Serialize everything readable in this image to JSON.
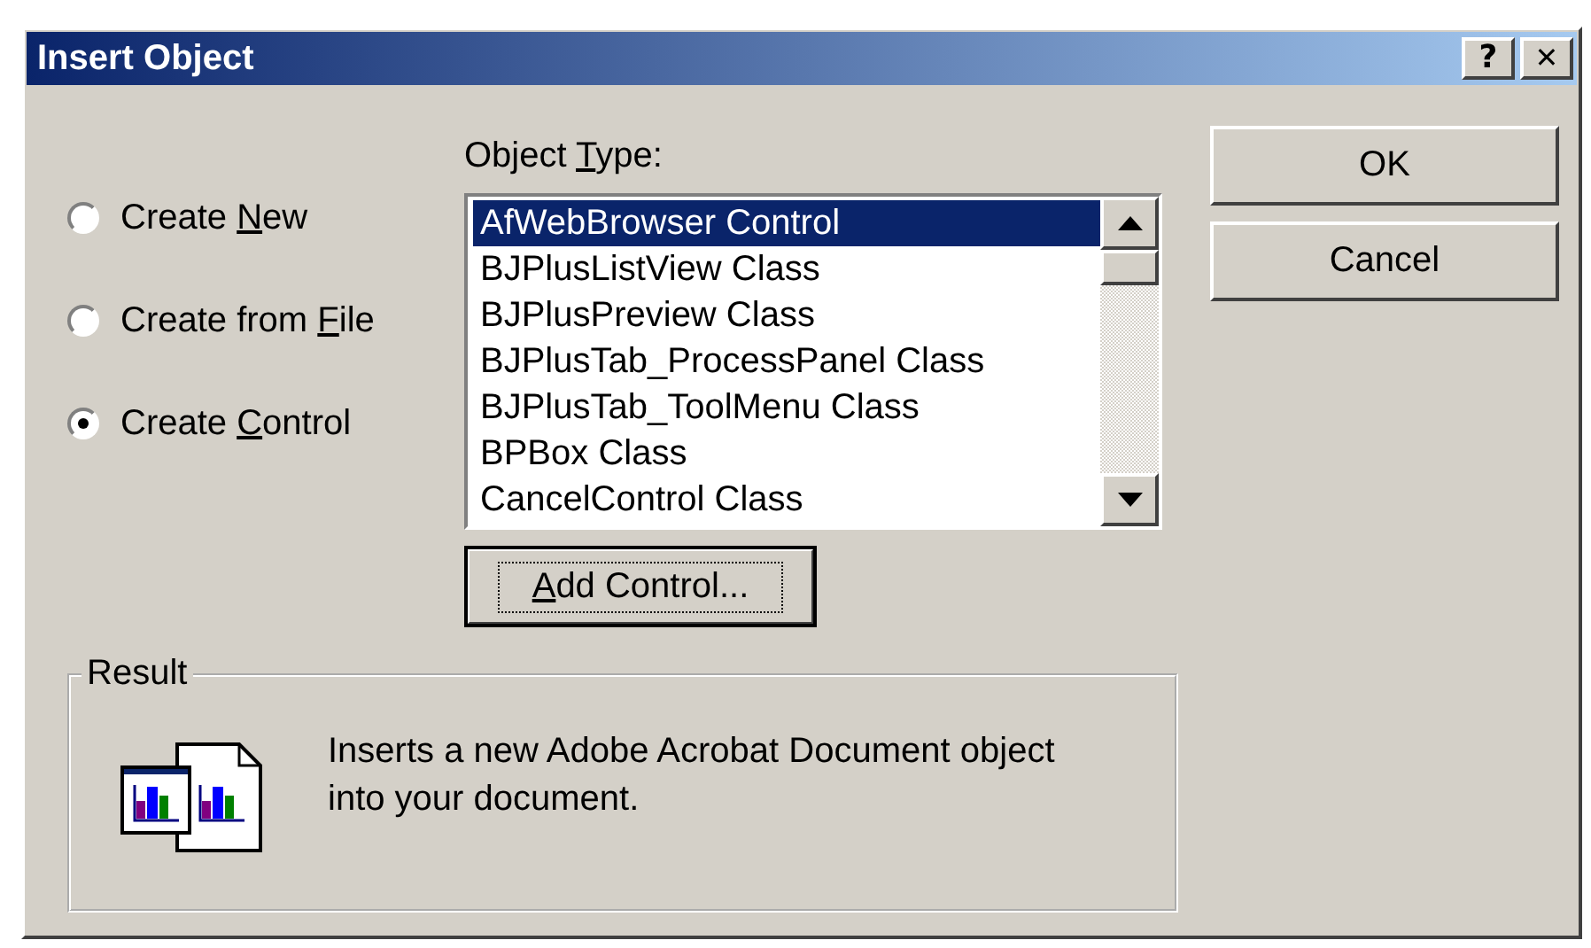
{
  "window": {
    "title": "Insert Object",
    "title_buttons": [
      {
        "kind": "help",
        "glyph": "?"
      },
      {
        "kind": "close",
        "glyph": "✕"
      }
    ]
  },
  "options": [
    {
      "before": "Create ",
      "key": "N",
      "after": "ew",
      "selected": false
    },
    {
      "before": "Create from ",
      "key": "F",
      "after": "ile",
      "selected": false
    },
    {
      "before": "Create ",
      "key": "C",
      "after": "ontrol",
      "selected": true
    }
  ],
  "object_type": {
    "label": {
      "before": "Object ",
      "key": "T",
      "after": "ype:"
    },
    "items": [
      {
        "text": "AfWebBrowser Control",
        "selected": true
      },
      {
        "text": "BJPlusListView Class",
        "selected": false
      },
      {
        "text": "BJPlusPreview Class",
        "selected": false
      },
      {
        "text": "BJPlusTab_ProcessPanel Class",
        "selected": false
      },
      {
        "text": "BJPlusTab_ToolMenu Class",
        "selected": false
      },
      {
        "text": "BPBox Class",
        "selected": false
      },
      {
        "text": "CancelControl Class",
        "selected": false
      }
    ]
  },
  "add_button": {
    "key": "A",
    "after": "dd Control...",
    "focused": true
  },
  "buttons": [
    {
      "text": "OK"
    },
    {
      "text": "Cancel"
    }
  ],
  "result": {
    "title": "Result",
    "text": "Inserts a new Adobe Acrobat Document object into your document."
  }
}
